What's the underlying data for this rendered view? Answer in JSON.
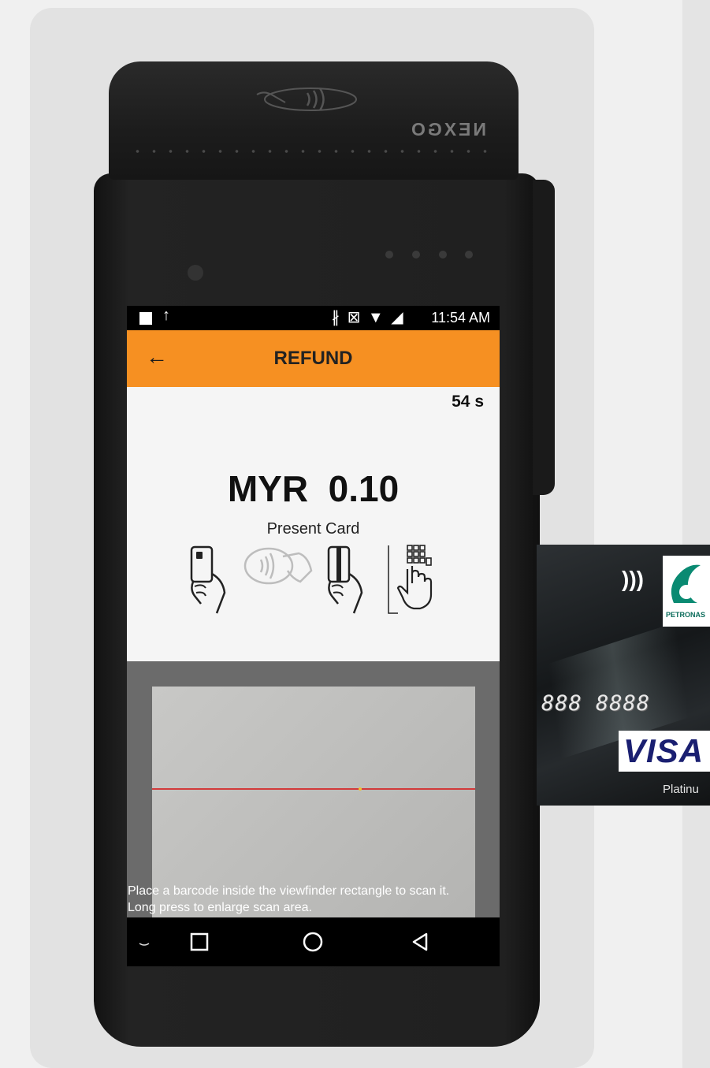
{
  "device": {
    "brand": "NEXGO"
  },
  "status_bar": {
    "time": "11:54 AM"
  },
  "app_bar": {
    "title": "REFUND",
    "back_icon": "arrow-left-icon"
  },
  "payment": {
    "countdown": "54 s",
    "amount": "MYR  0.10",
    "instruction": "Present Card",
    "methods": [
      {
        "name": "Insert chip card",
        "icon": "chip-card-icon"
      },
      {
        "name": "Tap contactless",
        "icon": "contactless-icon"
      },
      {
        "name": "Swipe card",
        "icon": "swipe-card-icon"
      },
      {
        "name": "Manual entry",
        "icon": "keypad-icon"
      }
    ]
  },
  "scanner": {
    "hint_line1": "Place a barcode inside the viewfinder rectangle to scan it.",
    "hint_line2": "Long press to enlarge scan area."
  },
  "card": {
    "number": "888 8888",
    "issuer": "PETRONAS",
    "network": "VISA",
    "tier": "Platinu"
  },
  "colors": {
    "app_bar": "#f69022",
    "screen_bg": "#f5f5f5",
    "laser": "#d23a3a"
  }
}
